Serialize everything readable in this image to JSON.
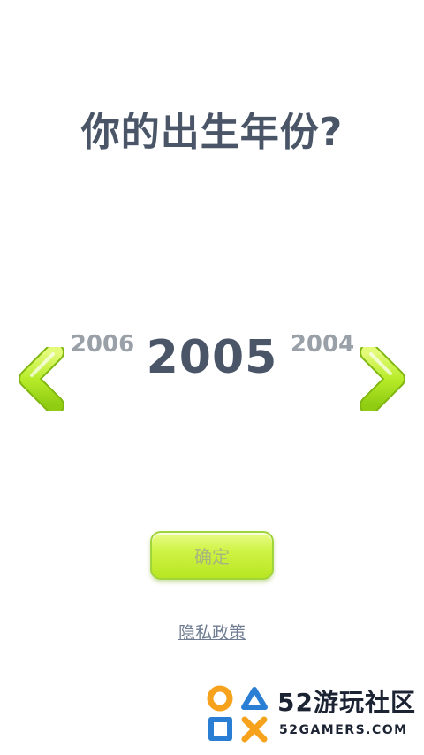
{
  "header": {
    "title": "你的出生年份?"
  },
  "year_picker": {
    "previous_year": "2006",
    "selected_year": "2005",
    "next_year": "2004",
    "left_arrow_icon": "chevron-left-icon",
    "right_arrow_icon": "chevron-right-icon",
    "arrow_color": "#a6e01c"
  },
  "actions": {
    "confirm_label": "确定",
    "privacy_label": "隐私政策"
  },
  "watermark": {
    "brand": "52游玩社区",
    "site": "52GAMERS.COM",
    "logo_icon": "gamepad-symbols-icon",
    "orange": "#f6a21c",
    "blue": "#2a7fd4"
  }
}
